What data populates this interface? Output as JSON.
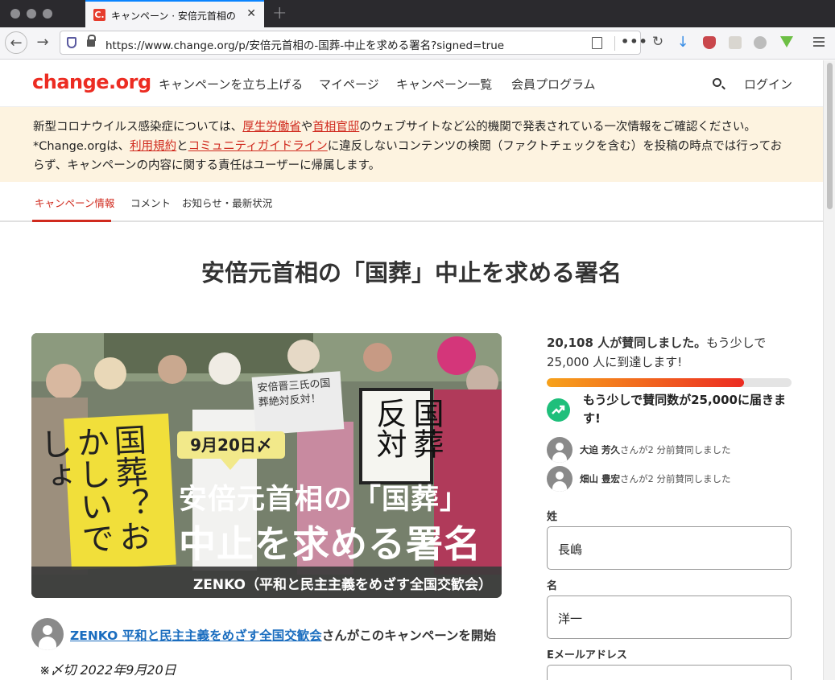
{
  "browser": {
    "tab_title": "キャンペーン · 安倍元首相の「国葬」中止を求める署名",
    "tab_favicon": "C.",
    "url": "https://www.change.org/p/安倍元首相の-国葬-中止を求める署名?signed=true",
    "more_label": "•••"
  },
  "site": {
    "logo": "change.org",
    "nav": [
      "キャンペーンを立ち上げる",
      "マイページ",
      "キャンペーン一覧",
      "会員プログラム"
    ],
    "login": "ログイン"
  },
  "notice": {
    "t1": "新型コロナウイルス感染症については、",
    "link1": "厚生労働省",
    "t2": "や",
    "link2": "首相官邸",
    "t3": "のウェブサイトなど公的機関で発表されている一次情報をご確認ください。*Change.orgは、",
    "link3": "利用規約",
    "t4": "と",
    "link4": "コミュニティガイドライン",
    "t5": "に違反しないコンテンツの検閲（ファクトチェックを含む）を投稿の時点では行っておらず、キャンペーンの内容に関する責任はユーザーに帰属します。"
  },
  "page_tabs": [
    "キャンペーン情報",
    "コメント",
    "お知らせ・最新状況"
  ],
  "title": "安倍元首相の「国葬」中止を求める署名",
  "hero": {
    "date": "9月20日〆",
    "line1": "安倍元首相の「国葬」",
    "line2": "中止を求める署名",
    "org": "ZENKO（平和と民主主義をめざす全国交歓会）",
    "sign_yellow": "国葬？おかしいでしょ",
    "sign_white": "国葬反対",
    "sign_small": "安倍晋三氏の国葬絶対反対！"
  },
  "starter": {
    "org_link": "ZENKO 平和と民主主義をめざす全国交歓会",
    "suffix": "さんがこのキャンペーンを開始"
  },
  "deadline": "※〆切 2022年9月20日",
  "progress": {
    "count_text": "20,108 人が賛同しました。",
    "rest": "もう少しで 25,000 人に到達します!",
    "signed": 20108,
    "goal": 25000,
    "goal_message": "もう少しで賛同数が25,000に届きます!",
    "goal_icon": "trending-up-icon"
  },
  "recent_signers": [
    {
      "name": "大迫 芳久",
      "text": "さんが2 分前賛同しました"
    },
    {
      "name": "畑山 豊宏",
      "text": "さんが2 分前賛同しました"
    }
  ],
  "form": {
    "last_name_label": "姓",
    "last_name_value": "長嶋",
    "first_name_label": "名",
    "first_name_value": "洋一",
    "email_label": "Eメールアドレス"
  },
  "colors": {
    "brand": "#ec2c22",
    "notice_bg": "#fdf3e0",
    "link": "#1a6dbf",
    "goal_green": "#1fbf7b"
  }
}
